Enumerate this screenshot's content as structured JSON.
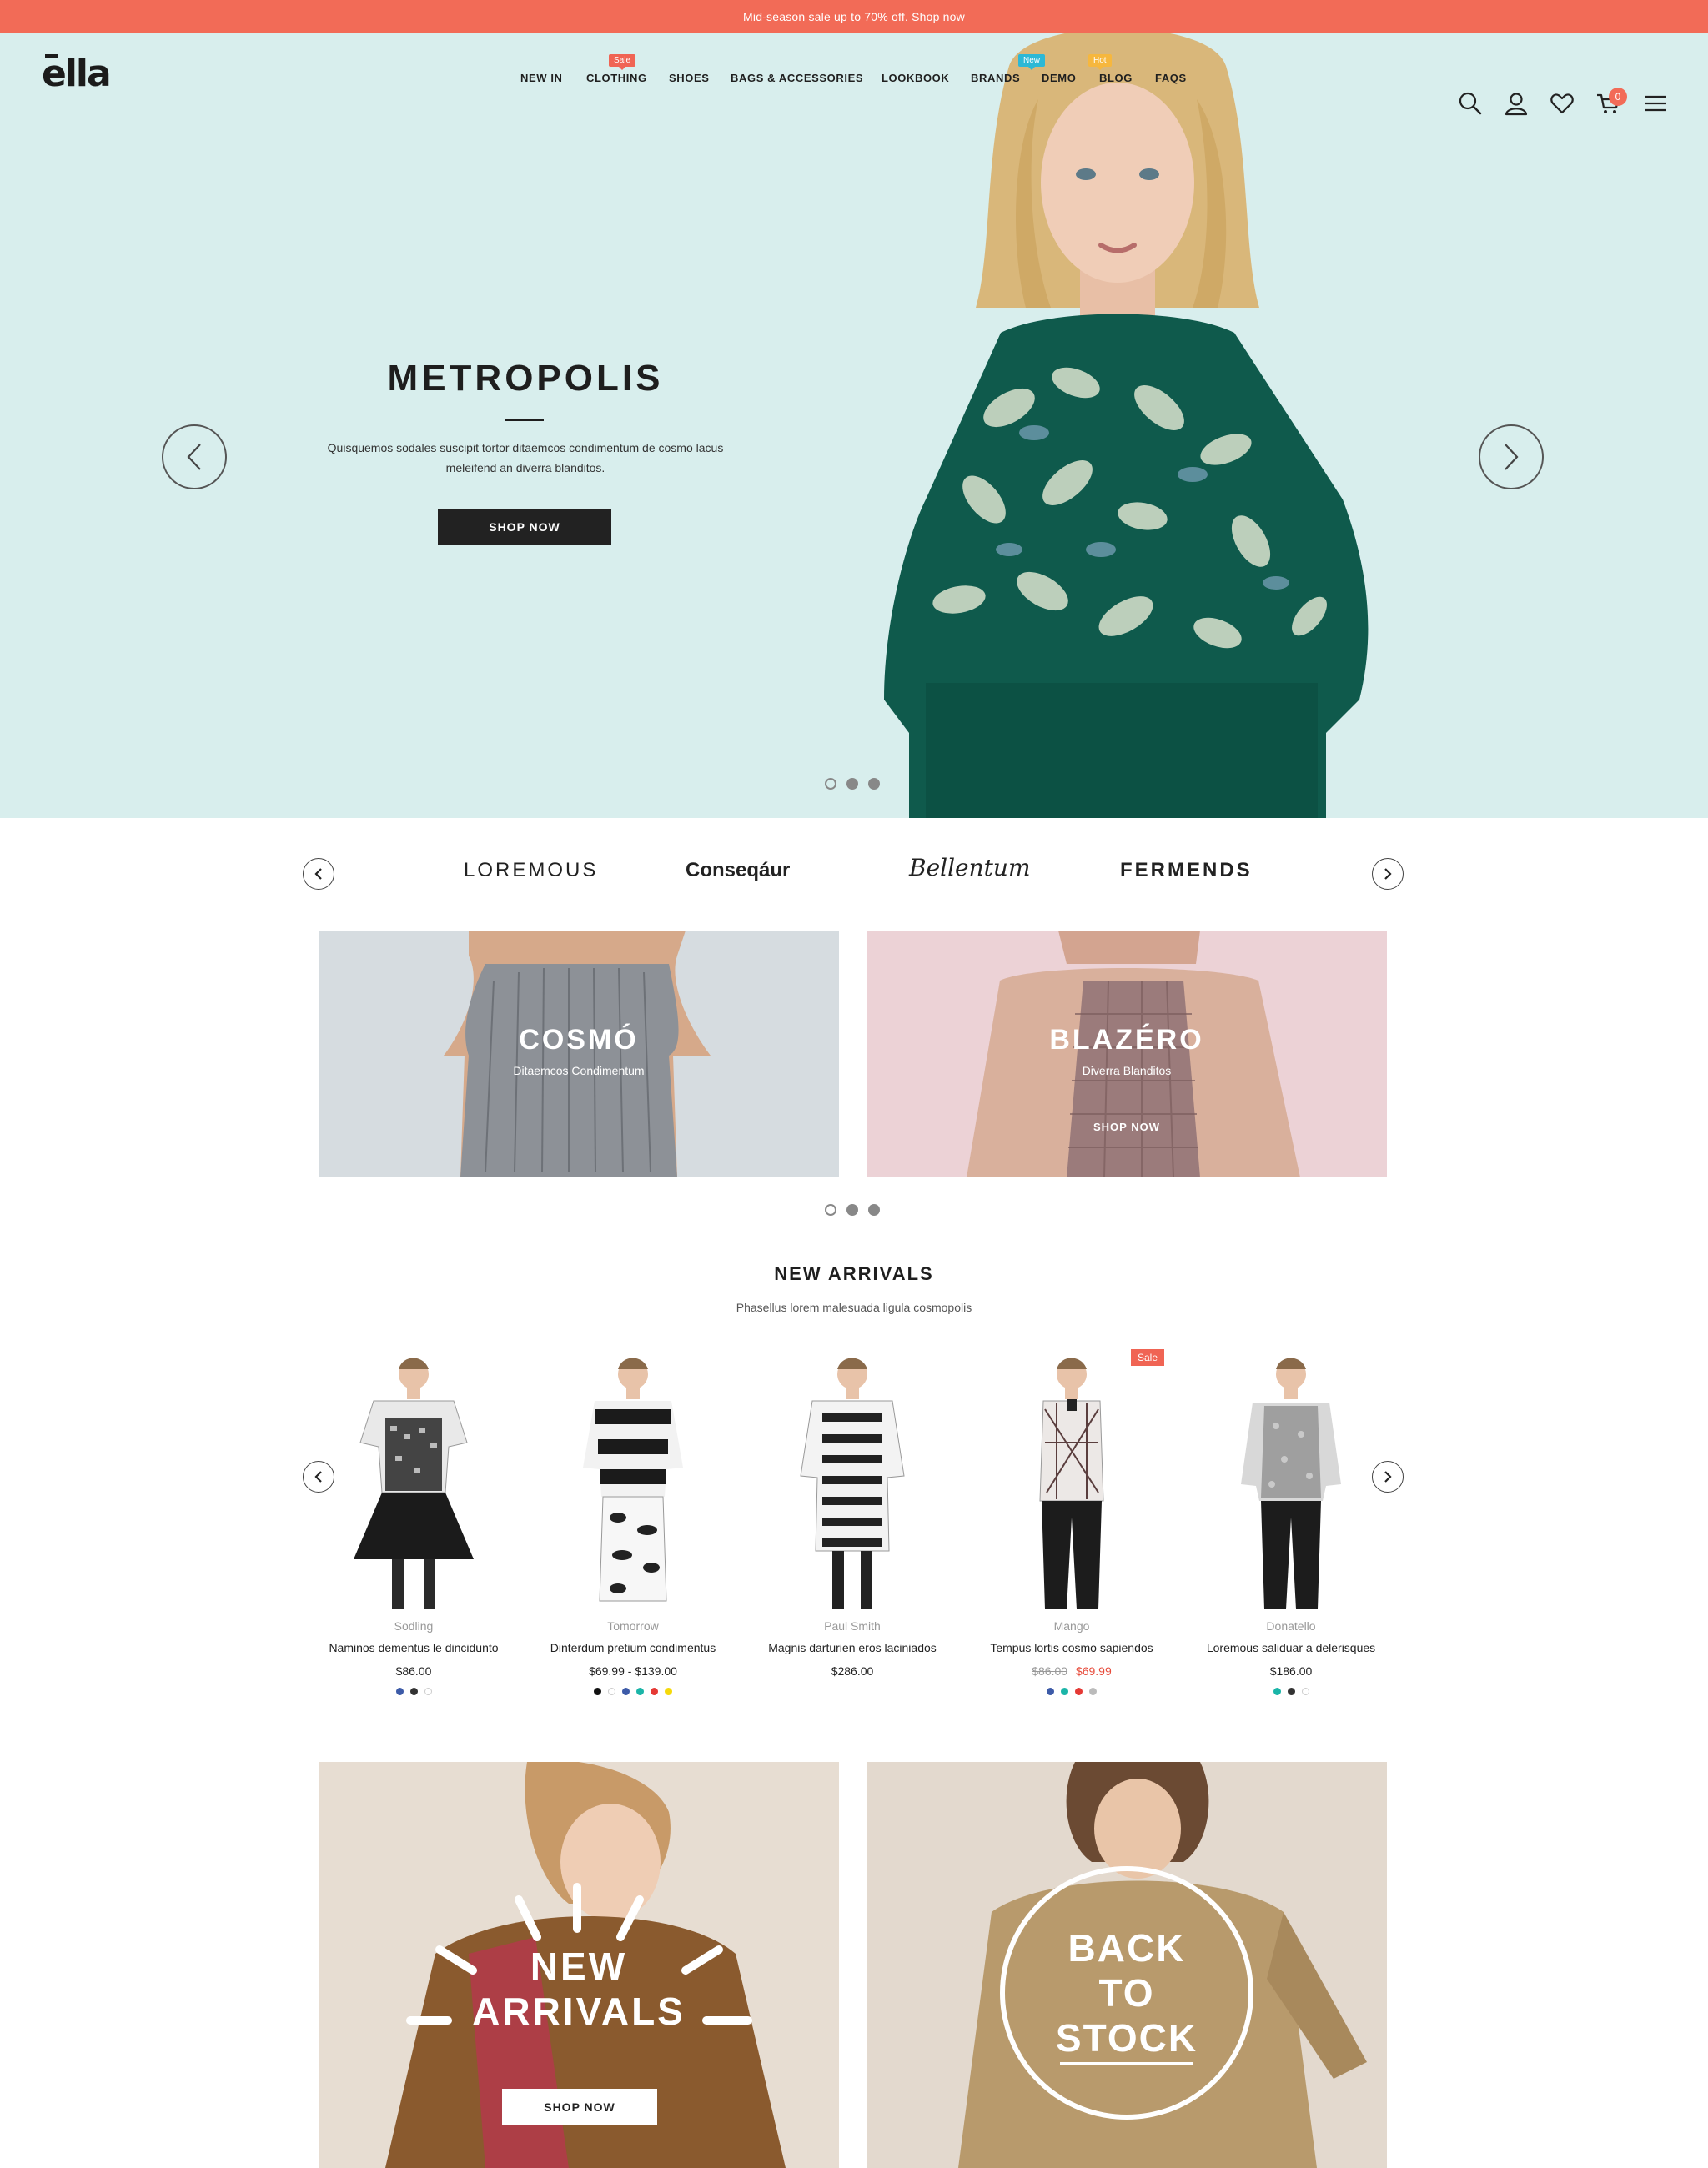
{
  "announcement": "Mid-season sale up to 70% off. Shop now",
  "logo": "ella",
  "nav": {
    "items": [
      "NEW IN",
      "CLOTHING",
      "SHOES",
      "BAGS & ACCESSORIES",
      "LOOKBOOK",
      "BRANDS",
      "DEMO",
      "BLOG",
      "FAQS"
    ],
    "badges": {
      "clothing": "Sale",
      "demo": "New",
      "blog": "Hot"
    },
    "cart_count": "0"
  },
  "hero": {
    "title": "METROPOLIS",
    "description": "Quisquemos sodales suscipit tortor ditaemcos condimentum de cosmo lacus meleifend an diverra blanditos.",
    "button": "SHOP NOW"
  },
  "brands": [
    "LOREMOUS",
    "Conseqáur",
    "Bellentum",
    "FERMENDS"
  ],
  "banners": [
    {
      "title": "COSMÓ",
      "subtitle": "Ditaemcos Condimentum"
    },
    {
      "title": "BLAZÉRO",
      "subtitle": "Diverra Blanditos",
      "link": "SHOP NOW"
    }
  ],
  "new_arrivals": {
    "title": "NEW ARRIVALS",
    "subtitle": "Phasellus lorem malesuada ligula cosmopolis",
    "sale_badge": "Sale",
    "products": [
      {
        "vendor": "Sodling",
        "name": "Naminos dementus le dincidunto",
        "price": "$86.00",
        "swatches": [
          "#3d5ba8",
          "#333333",
          "#ffffff"
        ]
      },
      {
        "vendor": "Tomorrow",
        "name": "Dinterdum pretium condimentus",
        "price": "$69.99 - $139.00",
        "swatches": [
          "#111111",
          "#ffffff",
          "#3d5ba8",
          "#1bb5a8",
          "#e53935",
          "#f5d90a"
        ]
      },
      {
        "vendor": "Paul Smith",
        "name": "Magnis darturien eros laciniados",
        "price": "$286.00",
        "swatches": []
      },
      {
        "vendor": "Mango",
        "name": "Tempus lortis cosmo sapiendos",
        "price_old": "$86.00",
        "price_new": "$69.99",
        "swatches": [
          "#3d5ba8",
          "#1bb5a8",
          "#e53935",
          "#bbbbbb"
        ]
      },
      {
        "vendor": "Donatello",
        "name": "Loremous saliduar a delerisques",
        "price": "$186.00",
        "swatches": [
          "#1bb5a8",
          "#333333",
          "#ffffff"
        ]
      }
    ]
  },
  "bottom_banners": [
    {
      "line1": "NEW",
      "line2": "ARRIVALS",
      "button": "SHOP NOW"
    },
    {
      "line1": "BACK",
      "line2": "TO",
      "line3": "STOCK"
    }
  ]
}
